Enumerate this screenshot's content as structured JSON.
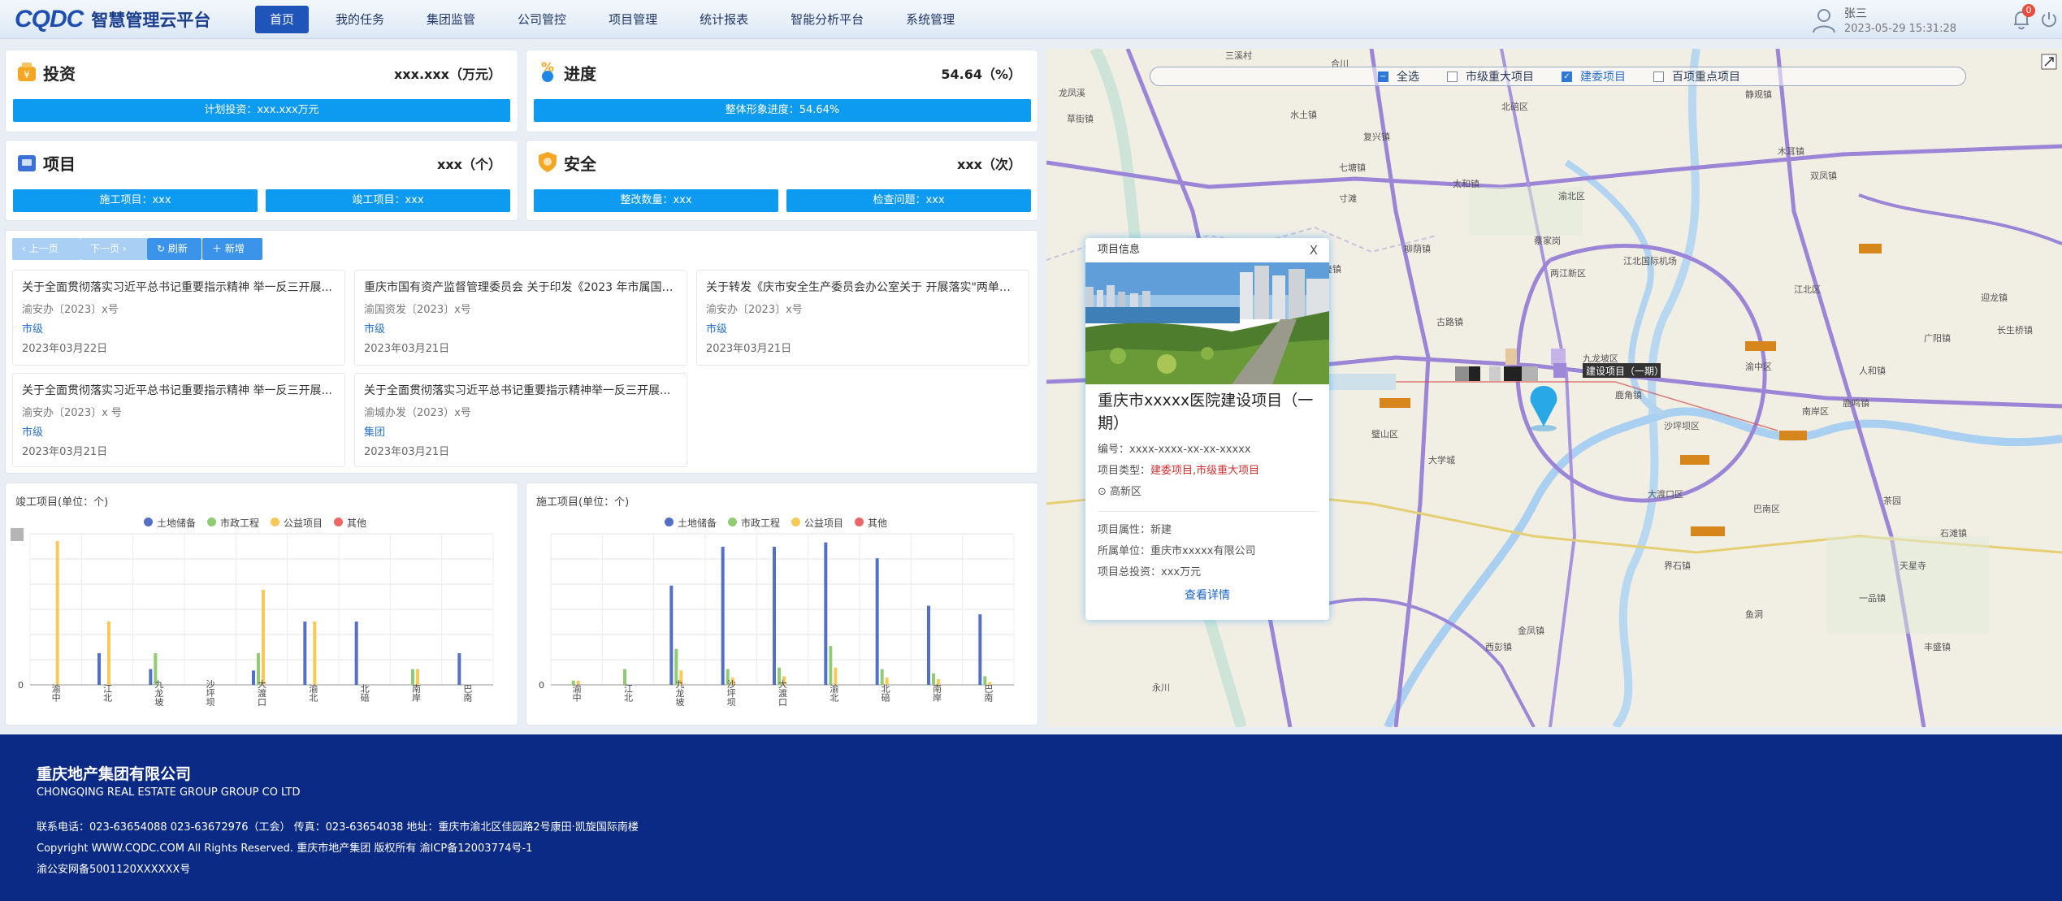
{
  "header": {
    "logo_text": "CQDC",
    "app_title": "智慧管理云平台",
    "nav": [
      "首页",
      "我的任务",
      "集团监管",
      "公司管控",
      "项目管理",
      "统计报表",
      "智能分析平台",
      "系统管理"
    ],
    "user_name": "张三",
    "datetime": "2023-05-29 15:31:28",
    "notification_count": "0"
  },
  "stats": {
    "invest": {
      "title": "投资",
      "value": "xxx.xxx（万元）",
      "bar": "计划投资：xxx.xxx万元"
    },
    "progress": {
      "title": "进度",
      "value": "54.64（%）",
      "bar": "整体形象进度：54.64%"
    },
    "project": {
      "title": "项目",
      "value": "xxx（个）",
      "bar1": "施工项目：xxx",
      "bar2": "竣工项目：xxx"
    },
    "safety": {
      "title": "安全",
      "value": "xxx（次）",
      "bar1": "整改数量：xxx",
      "bar2": "检查问题：xxx"
    }
  },
  "toolbar": {
    "prev": "上一页",
    "next": "下一页",
    "refresh": "刷新",
    "add": "新增"
  },
  "notices": [
    {
      "title": "关于全面贯彻落实习近平总书记重要指示精神 举一反三开展...",
      "code": "渝安办〔2023〕x号",
      "level": "市级",
      "date": "2023年03月22日"
    },
    {
      "title": "重庆市国有资产监督管理委员会 关于印发《2023 年市属国有...",
      "code": "渝国资发〔2023〕x号",
      "level": "市级",
      "date": "2023年03月21日"
    },
    {
      "title": "关于转发《庆市安全生产委员会办公室关于 开展落实\"两单两...",
      "code": "渝安办〔2023〕x号",
      "level": "市级",
      "date": "2023年03月21日"
    },
    {
      "title": "关于全面贯彻落实习近平总书记重要指示精神 举一反三开展...",
      "code": "渝安办〔2023〕x 号",
      "level": "市级",
      "date": "2023年03月21日"
    },
    {
      "title": "关于全面贯彻落实习近平总书记重要指示精神举一反三开展...",
      "code": "渝城办发（2023）x号",
      "level": "集团",
      "date": "2023年03月21日"
    }
  ],
  "charts_meta": {
    "left_title": "竣工项目(单位：个)",
    "right_title": "施工项目(单位：个)",
    "legend": [
      "土地储备",
      "市政工程",
      "公益项目",
      "其他"
    ],
    "left_zero": "0",
    "right_zero": "0"
  },
  "chart_data": [
    {
      "type": "bar",
      "title": "竣工项目(单位：个)",
      "categories": [
        "渝中",
        "江北",
        "九龙坡",
        "沙坪坝",
        "大渡口",
        "渝北",
        "北碚",
        "南岸",
        "巴南"
      ],
      "series": [
        {
          "name": "土地储备",
          "color": "#5470c6",
          "values": [
            0,
            2.2,
            1.1,
            0,
            1.0,
            4.4,
            4.4,
            0,
            2.2
          ]
        },
        {
          "name": "市政工程",
          "color": "#91cc75",
          "values": [
            0,
            0,
            2.2,
            0,
            2.2,
            0,
            0,
            1.1,
            0
          ]
        },
        {
          "name": "公益项目",
          "color": "#fac858",
          "values": [
            10,
            4.4,
            0,
            0,
            6.6,
            4.4,
            0,
            1.1,
            0
          ]
        },
        {
          "name": "其他",
          "color": "#ee6666",
          "values": [
            0,
            0,
            0,
            0,
            0,
            0,
            0,
            0,
            0
          ]
        }
      ],
      "ylim": [
        0,
        10.5
      ]
    },
    {
      "type": "bar",
      "title": "施工项目(单位：个)",
      "categories": [
        "渝中",
        "江北",
        "九龙坡",
        "沙坪坝",
        "大渡口",
        "渝北",
        "北碚",
        "南岸",
        "巴南"
      ],
      "series": [
        {
          "name": "土地储备",
          "color": "#5470c6",
          "values": [
            0,
            0,
            6.9,
            9.6,
            9.6,
            9.9,
            8.8,
            5.5,
            4.9
          ]
        },
        {
          "name": "市政工程",
          "color": "#91cc75",
          "values": [
            0.3,
            1.1,
            2.5,
            1.1,
            1.2,
            2.7,
            1.1,
            0.8,
            0.6
          ]
        },
        {
          "name": "公益项目",
          "color": "#fac858",
          "values": [
            0.3,
            0,
            1.0,
            0.5,
            0.6,
            1.2,
            0.5,
            0.4,
            0.2
          ]
        },
        {
          "name": "其他",
          "color": "#ee6666",
          "values": [
            0,
            0,
            0,
            0,
            0,
            0,
            0,
            0,
            0
          ]
        }
      ],
      "ylim": [
        0,
        10.5
      ]
    }
  ],
  "map": {
    "filters": [
      {
        "label": "全选",
        "checked": true
      },
      {
        "label": "市级重大项目",
        "checked": false
      },
      {
        "label": "建委项目",
        "checked": true
      },
      {
        "label": "百项重点项目",
        "checked": false
      }
    ],
    "marker_label": "建设项目（一期）",
    "places": [
      "三溪村",
      "合川",
      "龙凤溪",
      "草街镇",
      "水土镇",
      "复兴镇",
      "寸滩",
      "北碚区",
      "七塘镇",
      "太和镇",
      "柳荫镇",
      "蔡家岗",
      "两江新区",
      "江北国际机场",
      "渝北区",
      "木耳镇",
      "双凤镇",
      "静观镇",
      "五叶堂",
      "兴隆镇",
      "古路镇",
      "渝中区",
      "江北区",
      "南岸区",
      "巴南区",
      "沙坪坝区",
      "大渡口区",
      "九龙坡区",
      "璧山区",
      "大学城",
      "鹿角镇",
      "界石镇",
      "鱼洞",
      "一品镇",
      "天星寺",
      "石滩镇",
      "茶园",
      "鹿鸣镇",
      "广阳镇",
      "迎龙镇",
      "长生桥镇",
      "人和镇",
      "金凤镇",
      "西彭镇",
      "永川",
      "丰盛镇"
    ],
    "popup": {
      "header": "项目信息",
      "close": "X",
      "name": "重庆市xxxxx医院建设项目（一期）",
      "code_label": "编号：",
      "code": "xxxx-xxxx-xx-xx-xxxxx",
      "type_label": "项目类型：",
      "type": "建委项目,市级重大项目",
      "district": "高新区",
      "attr_label": "项目属性：",
      "attr": "新建",
      "owner_label": "所属单位：",
      "owner": "重庆市xxxxx有限公司",
      "invest_label": "项目总投资：",
      "invest": "xxx万元",
      "detail": "查看详情"
    }
  },
  "footer": {
    "company": "重庆地产集团有限公司",
    "company_en": "CHONGQING REAL ESTATE GROUP GROUP CO LTD",
    "contact": "联系电话：023-63654088 023-63672976（工会）    传真：023-63654038    地址：重庆市渝北区佳园路2号康田·凯旋国际南楼",
    "copyright": "Copyright WWW.CQDC.COM All Rights Reserved. 重庆市地产集团 版权所有 渝ICP备12003774号-1",
    "police": "渝公安网备5001120XXXXXX号"
  }
}
